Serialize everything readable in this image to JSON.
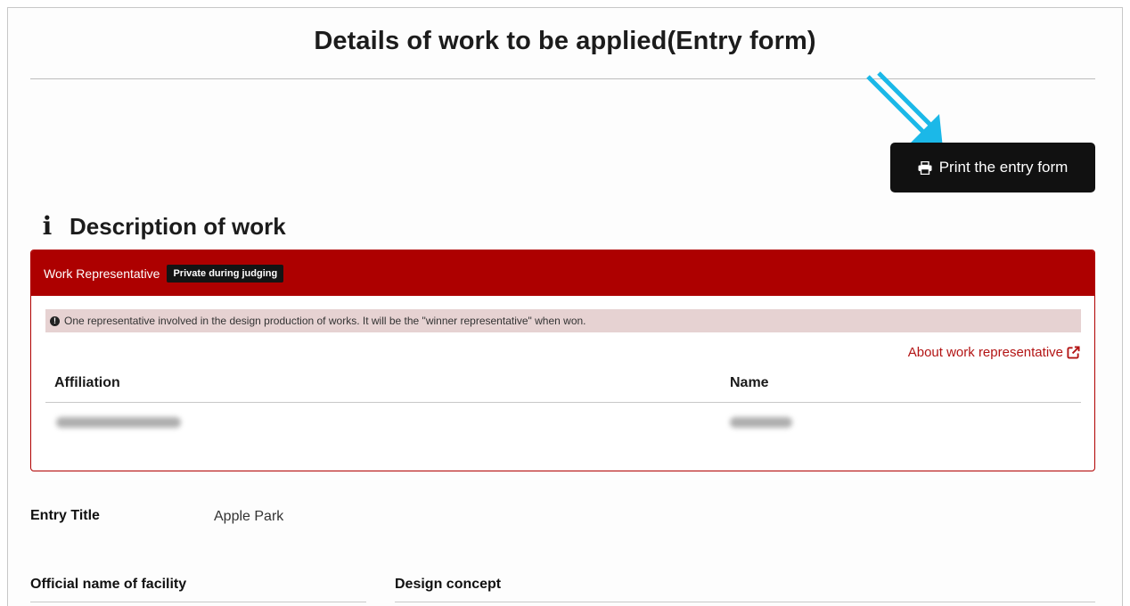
{
  "page": {
    "title": "Details of work to be applied(Entry form)"
  },
  "print_button": {
    "label": "Print the entry form",
    "icon": "printer-icon"
  },
  "annotation": {
    "icon": "double-arrow-icon",
    "color": "#1bb8e8"
  },
  "section": {
    "icon": "info-icon",
    "title": "Description of work"
  },
  "representative": {
    "header_label": "Work Representative",
    "badge": "Private during judging",
    "notice": "One representative involved in the design production of works. It will be the \"winner representative\" when won.",
    "link_label": "About work representative",
    "columns": [
      "Affiliation",
      "Name"
    ],
    "accent_color": "#ad0000"
  },
  "fields": {
    "entry_title_label": "Entry Title",
    "entry_title_value": "Apple Park",
    "facility_label": "Official name of facility",
    "design_concept_label": "Design concept"
  }
}
